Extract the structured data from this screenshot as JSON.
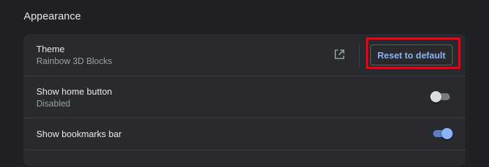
{
  "section": {
    "title": "Appearance"
  },
  "settings": {
    "theme": {
      "label": "Theme",
      "value": "Rainbow 3D Blocks",
      "open_icon": "open-in-new-icon",
      "reset_label": "Reset to default"
    },
    "home_button": {
      "label": "Show home button",
      "status": "Disabled",
      "enabled": false
    },
    "bookmarks_bar": {
      "label": "Show bookmarks bar",
      "enabled": true
    }
  },
  "colors": {
    "background": "#202124",
    "card": "#292a2d",
    "accent": "#8ab4f8",
    "highlight": "#d20f1a"
  }
}
